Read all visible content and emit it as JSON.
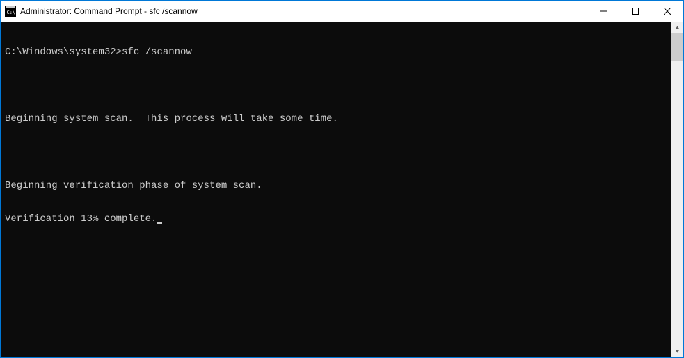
{
  "window": {
    "title": "Administrator: Command Prompt - sfc  /scannow"
  },
  "terminal": {
    "prompt": "C:\\Windows\\system32>",
    "command": "sfc /scannow",
    "lines": {
      "l1": "Beginning system scan.  This process will take some time.",
      "l2": "Beginning verification phase of system scan.",
      "l3": "Verification 13% complete."
    }
  }
}
